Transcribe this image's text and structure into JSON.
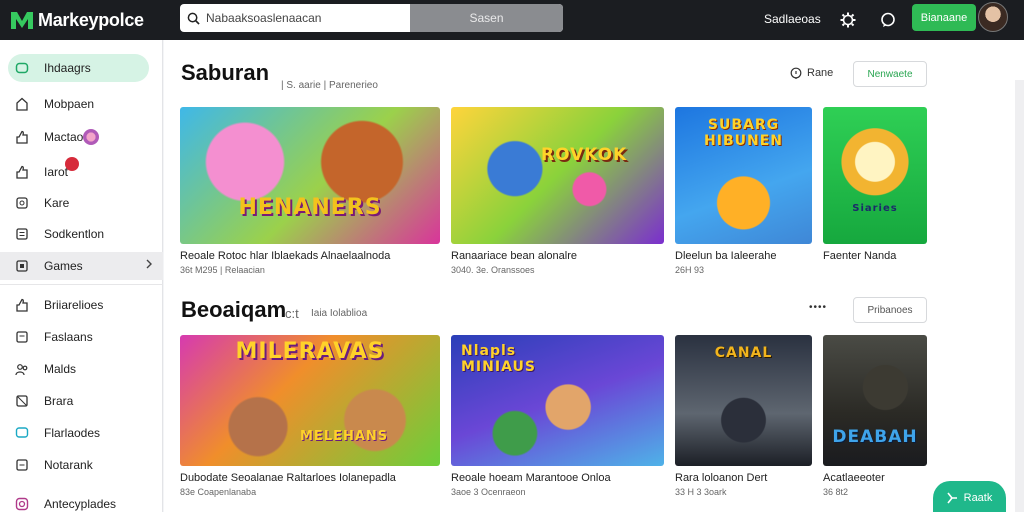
{
  "app": {
    "logo_text": "Markeypolce"
  },
  "topbar": {
    "search_placeholder": "Nabaaksoaslenaacan",
    "search_button": "Sasen",
    "link": "Sadlaeoas",
    "cta": "Bianaane"
  },
  "sidebar": {
    "items": [
      {
        "label": "Ihdaagrs"
      },
      {
        "label": "Mobpaen"
      },
      {
        "label": "Mactao"
      },
      {
        "label": "Iarot"
      },
      {
        "label": "Kare"
      },
      {
        "label": "Sodkentlon"
      },
      {
        "label": "Games"
      },
      {
        "label": "Briiarelioes"
      },
      {
        "label": "Faslaans"
      },
      {
        "label": "Malds"
      },
      {
        "label": "Brara"
      },
      {
        "label": "Flarlaodes"
      },
      {
        "label": "Notarank"
      },
      {
        "label": "Antecyplades"
      }
    ]
  },
  "sections": [
    {
      "title": "Saburan",
      "subtitle": "| S. aarie | Parenerieo",
      "link": "Rane",
      "button": "Nenwaete",
      "cards": [
        {
          "art_text": "HENANERS",
          "title": "Reoale Rotoc hlar Iblaekads Alnaelaalnoda",
          "meta": "36t M295 | Relaacian"
        },
        {
          "art_text": "ROVKOK",
          "title": "Ranaariace bean alonalre",
          "meta": "3040. 3e. Oranssoes"
        },
        {
          "art_text": "SUBARG HIBUNEN",
          "title": "Dleelun ba Ialeerahe",
          "meta": "26H 93"
        },
        {
          "art_text": "Siaries",
          "title": "Faenter Nanda",
          "meta": ""
        }
      ]
    },
    {
      "title": "Beoaiqam",
      "title_suffix": "c:t",
      "subtitle": "Iaia Iolablioa",
      "link": "••••",
      "button": "Pribanoes",
      "cards": [
        {
          "art_text": "MILERAVAS",
          "art_text2": "MELEHANS",
          "title": "Dubodate Seoalanae Raltarloes Iolanepadla",
          "meta": "83e Coapenlanaba"
        },
        {
          "art_text": "Nlapls MINIAUS",
          "title": "Reoale hoeam Marantooe Onloa",
          "meta": "3aoe 3 Ocenraeon"
        },
        {
          "art_text": "CANAL",
          "title": "Rara loloanon Dert",
          "meta": "33 H 3 3oark"
        },
        {
          "art_text": "DEABAH",
          "title": "Acatlaeeoter",
          "meta": "36 8t2"
        }
      ]
    }
  ],
  "fab": {
    "label": "Raatk"
  },
  "colors": {
    "accent": "#2fba55",
    "topbar": "#1b1d21",
    "teal": "#1fb88b"
  }
}
